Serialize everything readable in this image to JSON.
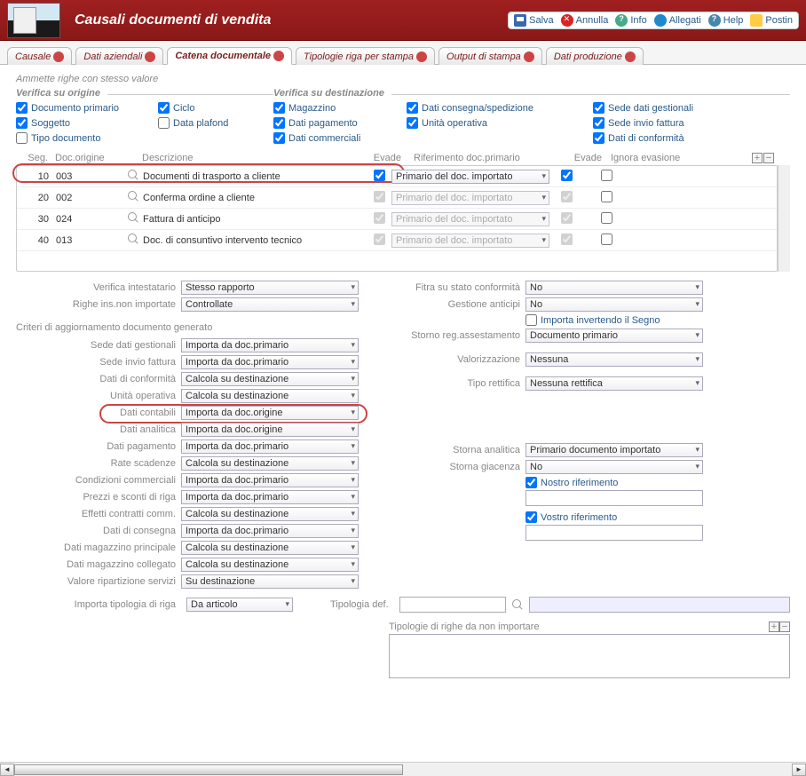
{
  "header": {
    "title": "Causali documenti di vendita"
  },
  "toolbar": {
    "save": "Salva",
    "cancel": "Annulla",
    "info": "Info",
    "attach": "Allegati",
    "help": "Help",
    "postin": "Postin"
  },
  "tabs": {
    "causale": "Causale",
    "dati_aziendali": "Dati aziendali",
    "catena": "Catena documentale",
    "tipologie": "Tipologie riga per stampa",
    "output": "Output di stampa",
    "produzione": "Dati produzione"
  },
  "subtitle": "Ammette righe con stesso valore",
  "fieldsets": {
    "origine_title": "Verifica su origine",
    "dest_title": "Verifica su destinazione",
    "doc_primario": "Documento primario",
    "soggetto": "Soggetto",
    "tipo_documento": "Tipo documento",
    "ciclo": "Ciclo",
    "data_plafond": "Data plafond",
    "magazzino": "Magazzino",
    "dati_pagamento": "Dati pagamento",
    "dati_commerciali": "Dati commerciali",
    "dati_consegna": "Dati consegna/spedizione",
    "unita_operativa": "Unità operativa",
    "sede_gestionali": "Sede dati gestionali",
    "sede_fattura": "Sede invio fattura",
    "dati_conformita": "Dati di conformità"
  },
  "grid": {
    "hdr_seq": "Seg.",
    "hdr_doc": "Doc.origine",
    "hdr_desc": "Descrizione",
    "hdr_evade": "Evade",
    "hdr_rif": "Riferimento doc.primario",
    "hdr_evade2": "Evade",
    "hdr_ignora": "Ignora evasione",
    "rows": [
      {
        "seq": "10",
        "doc": "003",
        "desc": "Documenti di trasporto a cliente",
        "rif": "Primario del doc. importato",
        "rif_enabled": true
      },
      {
        "seq": "20",
        "doc": "002",
        "desc": "Conferma ordine a cliente",
        "rif": "Primario del doc. importato",
        "rif_enabled": false
      },
      {
        "seq": "30",
        "doc": "024",
        "desc": "Fattura di anticipo",
        "rif": "Primario del doc. importato",
        "rif_enabled": false
      },
      {
        "seq": "40",
        "doc": "013",
        "desc": "Doc. di consuntivo intervento tecnico",
        "rif": "Primario del doc. importato",
        "rif_enabled": false
      }
    ]
  },
  "left": {
    "verifica_intestatario_lbl": "Verifica intestatario",
    "verifica_intestatario": "Stesso rapporto",
    "righe_non_importate_lbl": "Righe ins.non importate",
    "righe_non_importate": "Controllate",
    "criteri_title": "Criteri di aggiornamento documento generato",
    "sede_gestionali_lbl": "Sede dati gestionali",
    "sede_gestionali": "Importa da doc.primario",
    "sede_fattura_lbl": "Sede invio fattura",
    "sede_fattura": "Importa da doc.primario",
    "dati_conformita_lbl": "Dati di conformità",
    "dati_conformita": "Calcola su destinazione",
    "unita_operativa_lbl": "Unità operativa",
    "unita_operativa": "Calcola su destinazione",
    "dati_contabili_lbl": "Dati contabili",
    "dati_contabili": "Importa da doc.origine",
    "dati_analitica_lbl": "Dati analitica",
    "dati_analitica": "Importa da doc.origine",
    "dati_pagamento_lbl": "Dati pagamento",
    "dati_pagamento": "Importa da doc.primario",
    "rate_scadenze_lbl": "Rate scadenze",
    "rate_scadenze": "Calcola su destinazione",
    "cond_comm_lbl": "Condizioni commerciali",
    "cond_comm": "Importa da doc.primario",
    "prezzi_sconti_lbl": "Prezzi e sconti di riga",
    "prezzi_sconti": "Importa da doc.primario",
    "effetti_comm_lbl": "Effetti contratti comm.",
    "effetti_comm": "Calcola su destinazione",
    "dati_consegna_lbl": "Dati di consegna",
    "dati_consegna": "Importa da doc.primario",
    "mag_princ_lbl": "Dati magazzino principale",
    "mag_princ": "Calcola su destinazione",
    "mag_coll_lbl": "Dati magazzino collegato",
    "mag_coll": "Calcola su destinazione",
    "val_rip_lbl": "Valore ripartizione servizi",
    "val_rip": "Su destinazione",
    "imp_tipol_lbl": "Importa tipologia di riga",
    "imp_tipol": "Da articolo",
    "tipol_def_lbl": "Tipologia def.",
    "tipol_non_imp_lbl": "Tipologie di righe da non importare"
  },
  "right": {
    "filtra_lbl": "Fitra su stato conformità",
    "filtra": "No",
    "gest_anticipi_lbl": "Gestione anticipi",
    "gest_anticipi": "No",
    "importa_inv_lbl": "Importa invertendo il Segno",
    "storno_reg_lbl": "Storno reg.assestamento",
    "storno_reg": "Documento primario",
    "valorizzazione_lbl": "Valorizzazione",
    "valorizzazione": "Nessuna",
    "tipo_rettifica_lbl": "Tipo rettifica",
    "tipo_rettifica": "Nessuna rettifica",
    "storna_analitica_lbl": "Storna analitica",
    "storna_analitica": "Primario documento importato",
    "storna_giacenza_lbl": "Storna giacenza",
    "storna_giacenza": "No",
    "nostro_rif_lbl": "Nostro riferimento",
    "vostro_rif_lbl": "Vostro riferimento"
  }
}
